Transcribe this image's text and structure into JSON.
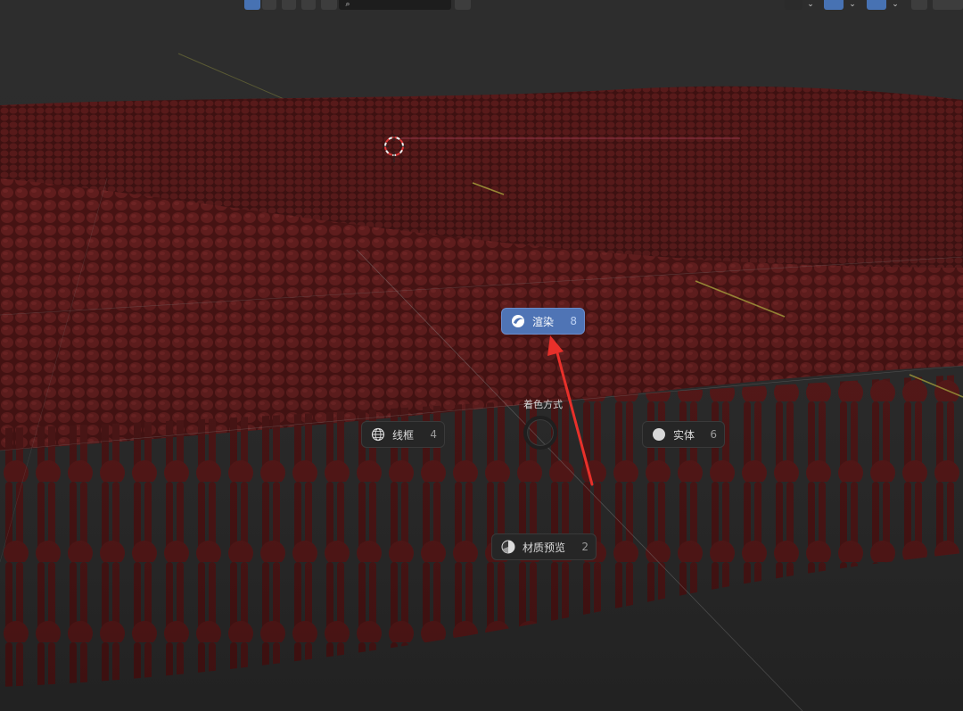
{
  "pie_menu": {
    "title": "着色方式",
    "options": [
      {
        "label": "渲染",
        "shortcut": "8",
        "icon": "render-sphere-icon",
        "active": true
      },
      {
        "label": "线框",
        "shortcut": "4",
        "icon": "wireframe-globe-icon",
        "active": false
      },
      {
        "label": "实体",
        "shortcut": "6",
        "icon": "solid-sphere-icon",
        "active": false
      },
      {
        "label": "材质预览",
        "shortcut": "2",
        "icon": "material-preview-icon",
        "active": false
      }
    ]
  },
  "colors": {
    "accent_active": "#4f74b5",
    "mesh_red": "#5a1a1a",
    "annotation_arrow": "#e8302a",
    "viewport_bg": "#2b2b2b"
  }
}
